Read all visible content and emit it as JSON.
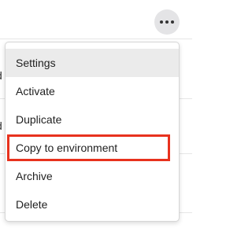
{
  "background": {
    "fragments": [
      "d",
      "d"
    ]
  },
  "more_button": {
    "icon": "more-horizontal-icon"
  },
  "menu": {
    "items": [
      {
        "label": "Settings",
        "state": "hovered"
      },
      {
        "label": "Activate"
      },
      {
        "label": "Duplicate"
      },
      {
        "label": "Copy to environment",
        "state": "highlighted",
        "highlight_color": "#e8321e"
      },
      {
        "label": "Archive"
      },
      {
        "label": "Delete"
      }
    ]
  }
}
